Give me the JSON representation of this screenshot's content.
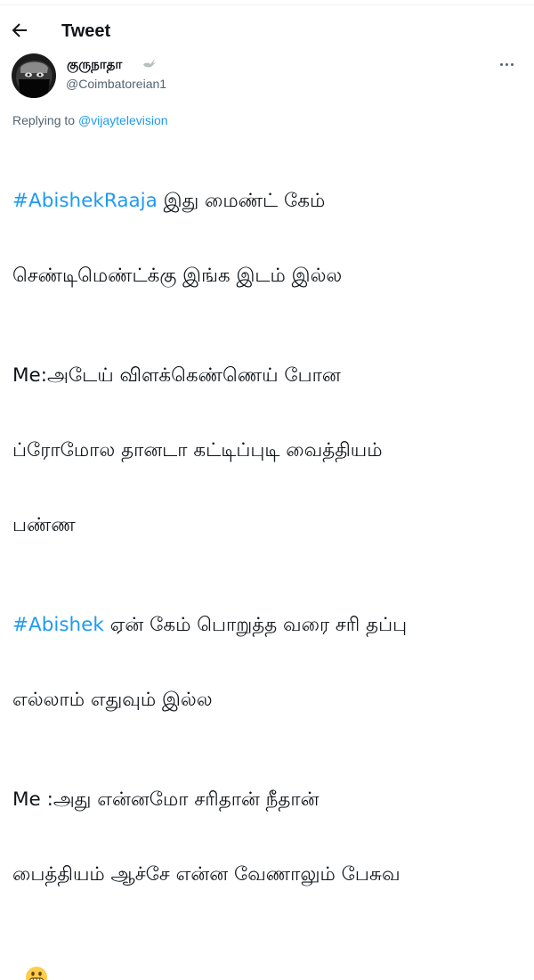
{
  "header": {
    "title": "Tweet"
  },
  "author": {
    "display_name": "குருநாதா",
    "handle": "@Coimbatoreian1"
  },
  "reply": {
    "prefix": "Replying to ",
    "to": "@vijaytelevision"
  },
  "tweet": {
    "p1_tag": "#AbishekRaaja",
    "p1_line1_rest": " இது மைண்ட் கேம்",
    "p1_line2": "செண்டிமெண்ட்க்கு இங்க இடம் இல்ல",
    "p2_line1": "Me:அடேய் விளக்கெண்ணெய் போன",
    "p2_line2": "ப்ரோமோல தானடா கட்டிப்புடி வைத்தியம்",
    "p2_line3": "பண்ண",
    "p3_tag": "#Abishek",
    "p3_line1_rest": " ஏன் கேம் பொறுத்த வரை சரி தப்பு",
    "p3_line2": "எல்லாம் எதுவும் இல்ல",
    "p4_line1": "Me :அது என்னமோ சரிதான் நீதான்",
    "p4_line2": "பைத்தியம் ஆச்சே என்ன வேணாலும் பேசுவ"
  },
  "icons": {
    "back": "back-arrow-icon",
    "more": "more-options-icon",
    "badge": "dove-icon",
    "emoji": "grimacing-face-emoji"
  },
  "colors": {
    "accent": "#1d9bf0",
    "text": "#0f1419",
    "muted": "#536471"
  }
}
